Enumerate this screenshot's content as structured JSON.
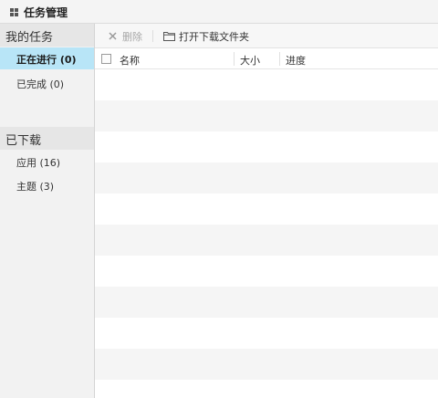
{
  "window": {
    "title": "任务管理",
    "icon": "grid-icon"
  },
  "sidebar": {
    "my_tasks": {
      "header": "我的任务",
      "items": [
        {
          "label": "正在进行 (0)",
          "active": true
        },
        {
          "label": "已完成 (0)",
          "active": false
        }
      ]
    },
    "downloaded": {
      "header": "已下载",
      "items": [
        {
          "label": "应用 (16)",
          "active": false
        },
        {
          "label": "主题 (3)",
          "active": false
        }
      ]
    }
  },
  "toolbar": {
    "delete_label": "删除",
    "delete_icon": "close-icon",
    "delete_enabled": false,
    "open_folder_label": "打开下载文件夹",
    "open_folder_icon": "folder-icon"
  },
  "table": {
    "columns": [
      "名称",
      "大小",
      "进度"
    ],
    "rows": []
  },
  "colors": {
    "active_item_bg": "#b8e5f7",
    "sidebar_bg": "#f2f2f2",
    "section_header_bg": "#e6e6e6",
    "stripe_bg": "#f5f5f5"
  }
}
